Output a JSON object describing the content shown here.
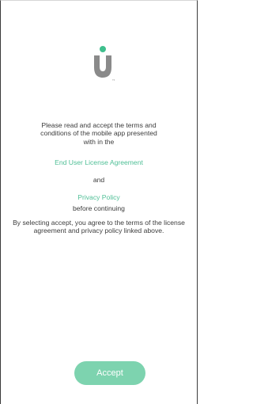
{
  "logo": {
    "icon": "u-logo-icon",
    "trademark": "TM",
    "accent_color": "#3fbf8d",
    "body_color": "#8a8a8a"
  },
  "content": {
    "intro": "Please read and accept the terms and conditions of the mobile app presented with in the",
    "eula_link": "End User License Agreement",
    "and": "and",
    "privacy_link": "Privacy Policy",
    "before": "before continuing",
    "terms": "By selecting accept, you agree to the terms of the license agreement and privacy policy linked above."
  },
  "actions": {
    "accept_label": "Accept"
  },
  "colors": {
    "link": "#4fbf96",
    "button": "#7dd3af",
    "text": "#3c3c3c"
  }
}
